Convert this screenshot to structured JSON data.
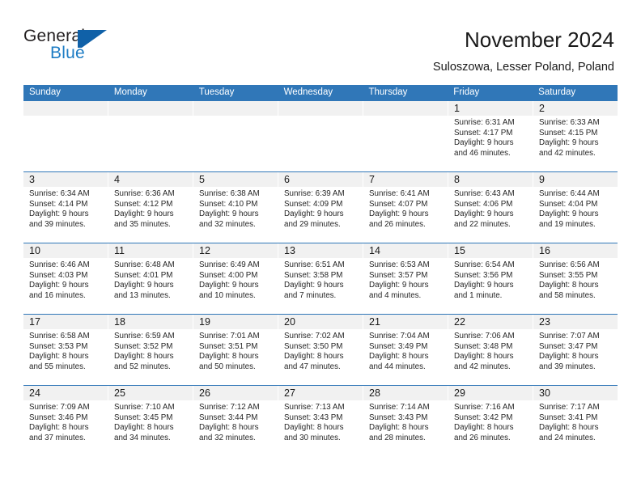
{
  "brand": {
    "name_part1": "General",
    "name_part2": "Blue",
    "accent_color": "#1061a8",
    "blue_text_color": "#1d7cc4",
    "logo_icon": "triangle-flag-icon"
  },
  "header": {
    "title": "November 2024",
    "subtitle": "Suloszowa, Lesser Poland, Poland"
  },
  "calendar": {
    "header_bg": "#3077b8",
    "date_band_bg": "#f1f1f1",
    "weekdays": [
      "Sunday",
      "Monday",
      "Tuesday",
      "Wednesday",
      "Thursday",
      "Friday",
      "Saturday"
    ],
    "weeks": [
      [
        {
          "date": "",
          "empty": true
        },
        {
          "date": "",
          "empty": true
        },
        {
          "date": "",
          "empty": true
        },
        {
          "date": "",
          "empty": true
        },
        {
          "date": "",
          "empty": true
        },
        {
          "date": "1",
          "sunrise": "Sunrise: 6:31 AM",
          "sunset": "Sunset: 4:17 PM",
          "daylight_line1": "Daylight: 9 hours",
          "daylight_line2": "and 46 minutes."
        },
        {
          "date": "2",
          "sunrise": "Sunrise: 6:33 AM",
          "sunset": "Sunset: 4:15 PM",
          "daylight_line1": "Daylight: 9 hours",
          "daylight_line2": "and 42 minutes."
        }
      ],
      [
        {
          "date": "3",
          "sunrise": "Sunrise: 6:34 AM",
          "sunset": "Sunset: 4:14 PM",
          "daylight_line1": "Daylight: 9 hours",
          "daylight_line2": "and 39 minutes."
        },
        {
          "date": "4",
          "sunrise": "Sunrise: 6:36 AM",
          "sunset": "Sunset: 4:12 PM",
          "daylight_line1": "Daylight: 9 hours",
          "daylight_line2": "and 35 minutes."
        },
        {
          "date": "5",
          "sunrise": "Sunrise: 6:38 AM",
          "sunset": "Sunset: 4:10 PM",
          "daylight_line1": "Daylight: 9 hours",
          "daylight_line2": "and 32 minutes."
        },
        {
          "date": "6",
          "sunrise": "Sunrise: 6:39 AM",
          "sunset": "Sunset: 4:09 PM",
          "daylight_line1": "Daylight: 9 hours",
          "daylight_line2": "and 29 minutes."
        },
        {
          "date": "7",
          "sunrise": "Sunrise: 6:41 AM",
          "sunset": "Sunset: 4:07 PM",
          "daylight_line1": "Daylight: 9 hours",
          "daylight_line2": "and 26 minutes."
        },
        {
          "date": "8",
          "sunrise": "Sunrise: 6:43 AM",
          "sunset": "Sunset: 4:06 PM",
          "daylight_line1": "Daylight: 9 hours",
          "daylight_line2": "and 22 minutes."
        },
        {
          "date": "9",
          "sunrise": "Sunrise: 6:44 AM",
          "sunset": "Sunset: 4:04 PM",
          "daylight_line1": "Daylight: 9 hours",
          "daylight_line2": "and 19 minutes."
        }
      ],
      [
        {
          "date": "10",
          "sunrise": "Sunrise: 6:46 AM",
          "sunset": "Sunset: 4:03 PM",
          "daylight_line1": "Daylight: 9 hours",
          "daylight_line2": "and 16 minutes."
        },
        {
          "date": "11",
          "sunrise": "Sunrise: 6:48 AM",
          "sunset": "Sunset: 4:01 PM",
          "daylight_line1": "Daylight: 9 hours",
          "daylight_line2": "and 13 minutes."
        },
        {
          "date": "12",
          "sunrise": "Sunrise: 6:49 AM",
          "sunset": "Sunset: 4:00 PM",
          "daylight_line1": "Daylight: 9 hours",
          "daylight_line2": "and 10 minutes."
        },
        {
          "date": "13",
          "sunrise": "Sunrise: 6:51 AM",
          "sunset": "Sunset: 3:58 PM",
          "daylight_line1": "Daylight: 9 hours",
          "daylight_line2": "and 7 minutes."
        },
        {
          "date": "14",
          "sunrise": "Sunrise: 6:53 AM",
          "sunset": "Sunset: 3:57 PM",
          "daylight_line1": "Daylight: 9 hours",
          "daylight_line2": "and 4 minutes."
        },
        {
          "date": "15",
          "sunrise": "Sunrise: 6:54 AM",
          "sunset": "Sunset: 3:56 PM",
          "daylight_line1": "Daylight: 9 hours",
          "daylight_line2": "and 1 minute."
        },
        {
          "date": "16",
          "sunrise": "Sunrise: 6:56 AM",
          "sunset": "Sunset: 3:55 PM",
          "daylight_line1": "Daylight: 8 hours",
          "daylight_line2": "and 58 minutes."
        }
      ],
      [
        {
          "date": "17",
          "sunrise": "Sunrise: 6:58 AM",
          "sunset": "Sunset: 3:53 PM",
          "daylight_line1": "Daylight: 8 hours",
          "daylight_line2": "and 55 minutes."
        },
        {
          "date": "18",
          "sunrise": "Sunrise: 6:59 AM",
          "sunset": "Sunset: 3:52 PM",
          "daylight_line1": "Daylight: 8 hours",
          "daylight_line2": "and 52 minutes."
        },
        {
          "date": "19",
          "sunrise": "Sunrise: 7:01 AM",
          "sunset": "Sunset: 3:51 PM",
          "daylight_line1": "Daylight: 8 hours",
          "daylight_line2": "and 50 minutes."
        },
        {
          "date": "20",
          "sunrise": "Sunrise: 7:02 AM",
          "sunset": "Sunset: 3:50 PM",
          "daylight_line1": "Daylight: 8 hours",
          "daylight_line2": "and 47 minutes."
        },
        {
          "date": "21",
          "sunrise": "Sunrise: 7:04 AM",
          "sunset": "Sunset: 3:49 PM",
          "daylight_line1": "Daylight: 8 hours",
          "daylight_line2": "and 44 minutes."
        },
        {
          "date": "22",
          "sunrise": "Sunrise: 7:06 AM",
          "sunset": "Sunset: 3:48 PM",
          "daylight_line1": "Daylight: 8 hours",
          "daylight_line2": "and 42 minutes."
        },
        {
          "date": "23",
          "sunrise": "Sunrise: 7:07 AM",
          "sunset": "Sunset: 3:47 PM",
          "daylight_line1": "Daylight: 8 hours",
          "daylight_line2": "and 39 minutes."
        }
      ],
      [
        {
          "date": "24",
          "sunrise": "Sunrise: 7:09 AM",
          "sunset": "Sunset: 3:46 PM",
          "daylight_line1": "Daylight: 8 hours",
          "daylight_line2": "and 37 minutes."
        },
        {
          "date": "25",
          "sunrise": "Sunrise: 7:10 AM",
          "sunset": "Sunset: 3:45 PM",
          "daylight_line1": "Daylight: 8 hours",
          "daylight_line2": "and 34 minutes."
        },
        {
          "date": "26",
          "sunrise": "Sunrise: 7:12 AM",
          "sunset": "Sunset: 3:44 PM",
          "daylight_line1": "Daylight: 8 hours",
          "daylight_line2": "and 32 minutes."
        },
        {
          "date": "27",
          "sunrise": "Sunrise: 7:13 AM",
          "sunset": "Sunset: 3:43 PM",
          "daylight_line1": "Daylight: 8 hours",
          "daylight_line2": "and 30 minutes."
        },
        {
          "date": "28",
          "sunrise": "Sunrise: 7:14 AM",
          "sunset": "Sunset: 3:43 PM",
          "daylight_line1": "Daylight: 8 hours",
          "daylight_line2": "and 28 minutes."
        },
        {
          "date": "29",
          "sunrise": "Sunrise: 7:16 AM",
          "sunset": "Sunset: 3:42 PM",
          "daylight_line1": "Daylight: 8 hours",
          "daylight_line2": "and 26 minutes."
        },
        {
          "date": "30",
          "sunrise": "Sunrise: 7:17 AM",
          "sunset": "Sunset: 3:41 PM",
          "daylight_line1": "Daylight: 8 hours",
          "daylight_line2": "and 24 minutes."
        }
      ]
    ]
  }
}
